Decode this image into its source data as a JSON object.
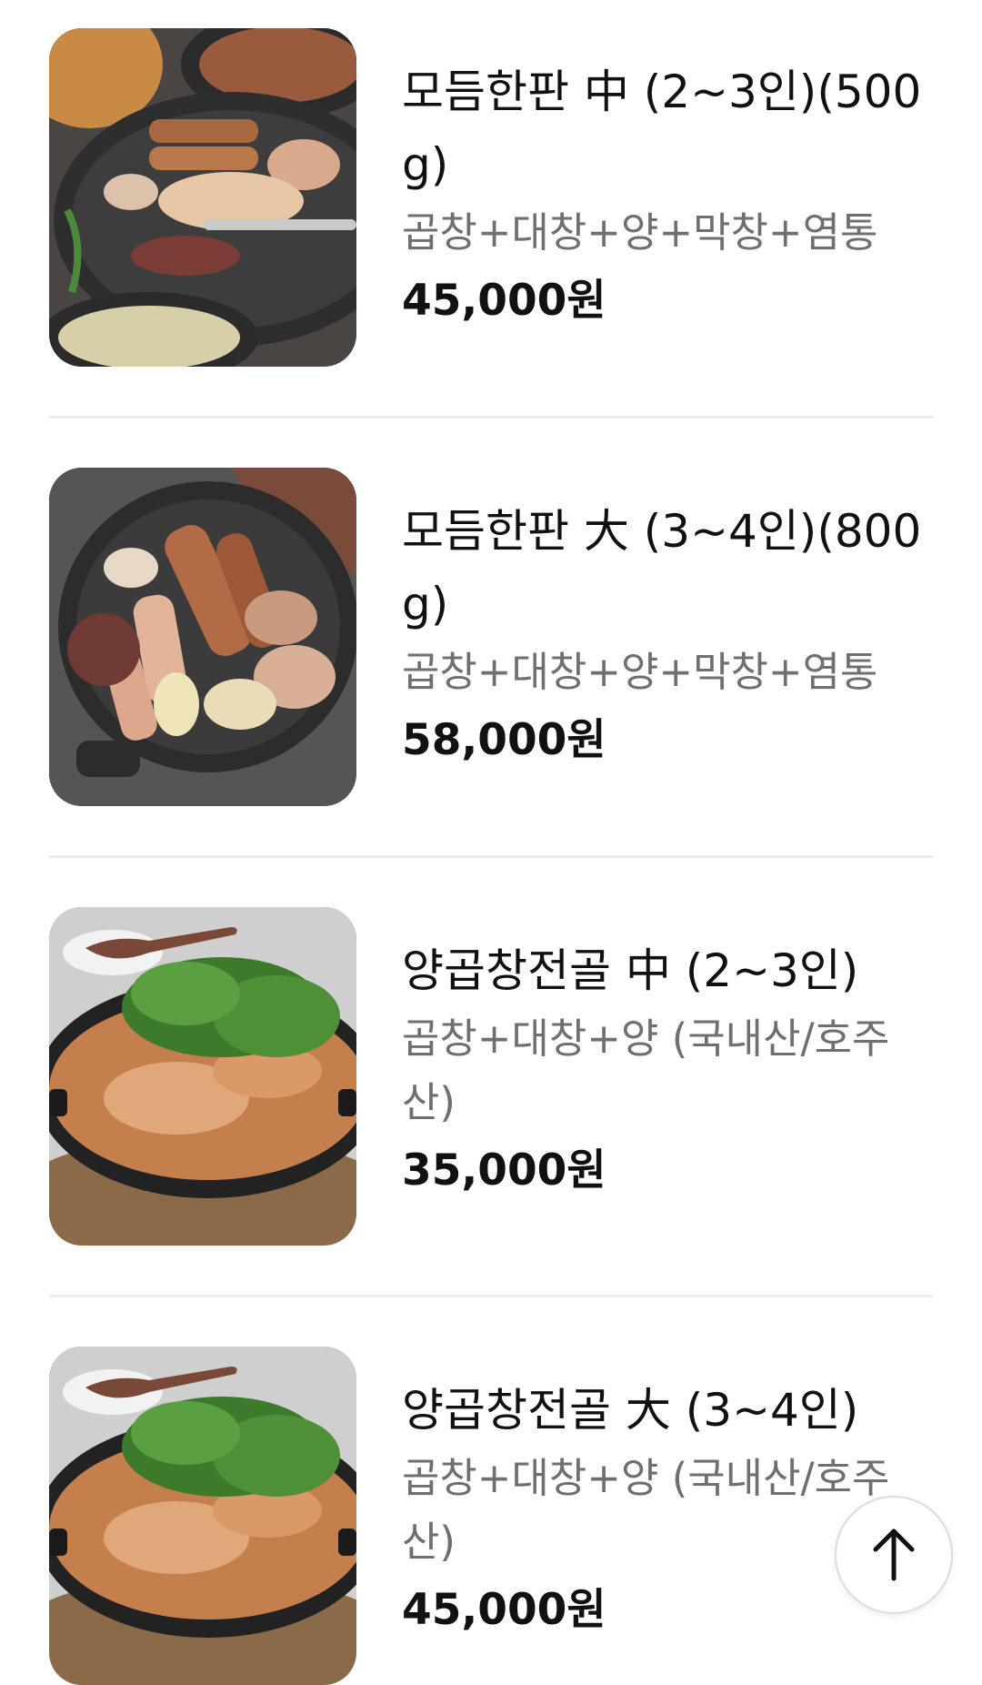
{
  "menu_items": [
    {
      "name": "모듬한판 中 (2~3인)(500g)",
      "description": "곱창+대창+양+막창+염통",
      "price": "45,000원",
      "image_icon": "grilled-tripe-platter-photo"
    },
    {
      "name": "모듬한판 大 (3~4인)(800g)",
      "description": "곱창+대창+양+막창+염통",
      "price": "58,000원",
      "image_icon": "grilled-tripe-platter-photo"
    },
    {
      "name": "양곱창전골 中 (2~3인)",
      "description": "곱창+대창+양 (국내산/호주산)",
      "price": "35,000원",
      "image_icon": "tripe-hotpot-photo"
    },
    {
      "name": "양곱창전골 大 (3~4인)",
      "description": "곱창+대창+양 (국내산/호주산)",
      "price": "45,000원",
      "image_icon": "tripe-hotpot-photo"
    }
  ],
  "scroll_top_button": {
    "icon": "arrow-up-icon"
  }
}
